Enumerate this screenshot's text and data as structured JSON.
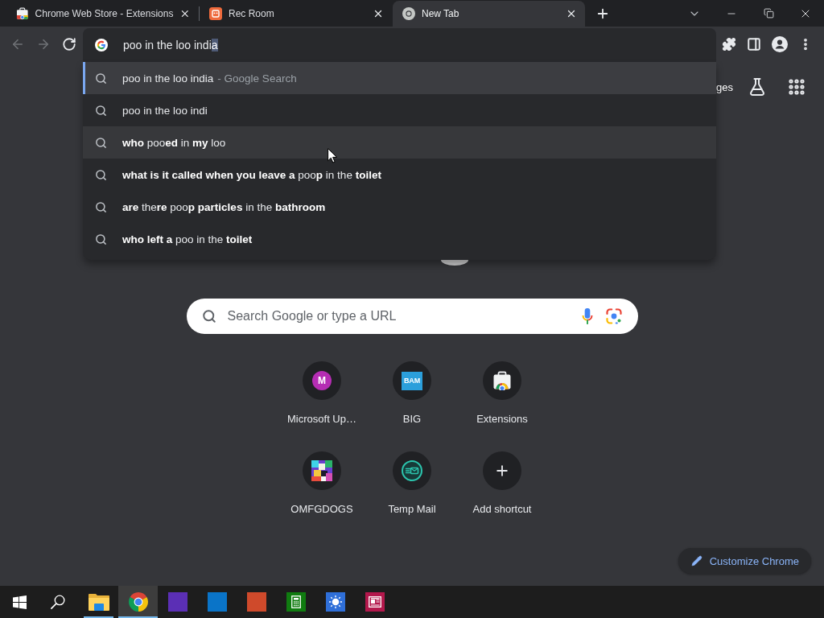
{
  "tabs": [
    {
      "title": "Chrome Web Store - Extensions",
      "kind": "store",
      "selected": false
    },
    {
      "title": "Rec Room",
      "kind": "recroom",
      "selected": false
    },
    {
      "title": "New Tab",
      "kind": "chrome",
      "selected": true
    }
  ],
  "navigation": {
    "back_disabled": true,
    "forward_disabled": true
  },
  "omnibox": {
    "value": "poo in the loo indi",
    "completion": "a"
  },
  "suggestions": [
    {
      "text": "poo in the loo india",
      "description": "- Google Search",
      "selected": true,
      "hovered": false
    },
    {
      "text": "poo in the loo indi",
      "selected": false,
      "hovered": false
    },
    {
      "text": "**who** poo**ed** in **my** loo",
      "selected": false,
      "hovered": true
    },
    {
      "text": "**what is it called when you leave a** poo**p** in the **toilet**",
      "selected": false,
      "hovered": false
    },
    {
      "text": "**are** the**re** poo**p particles** in the **bathroom**",
      "selected": false,
      "hovered": false
    },
    {
      "text": "**who left a** poo in the **toilet**",
      "selected": false,
      "hovered": false
    }
  ],
  "new_tab_page": {
    "header_link": "ges",
    "search": {
      "placeholder": "Search Google or type a URL"
    },
    "shortcuts": [
      {
        "title": "Microsoft Up…",
        "kind": "letter",
        "icon_text": "M"
      },
      {
        "title": "BIG",
        "kind": "badge",
        "icon_text": "BAM"
      },
      {
        "title": "Extensions",
        "kind": "store"
      },
      {
        "title": "OMFGDOGS",
        "kind": "artwork"
      },
      {
        "title": "Temp Mail",
        "kind": "mail"
      },
      {
        "title": "Add shortcut",
        "kind": "add"
      }
    ],
    "customize_button": "Customize Chrome"
  },
  "taskbar": {
    "apps": [
      {
        "kind": "folder",
        "running": true,
        "selected": false
      },
      {
        "kind": "chrome",
        "running": true,
        "selected": true
      },
      {
        "kind": "tile",
        "color": "#5b2fb5",
        "running": false,
        "selected": false
      },
      {
        "kind": "tile",
        "color": "#0a74c8",
        "running": false,
        "selected": false
      },
      {
        "kind": "tile",
        "color": "#cf4a2b",
        "running": false,
        "selected": false
      },
      {
        "kind": "calculator",
        "color": "#107c10",
        "running": false,
        "selected": false
      },
      {
        "kind": "photos",
        "color": "#2f6fd8",
        "running": false,
        "selected": false
      },
      {
        "kind": "news",
        "color": "#b3184c",
        "running": false,
        "selected": false
      }
    ]
  }
}
